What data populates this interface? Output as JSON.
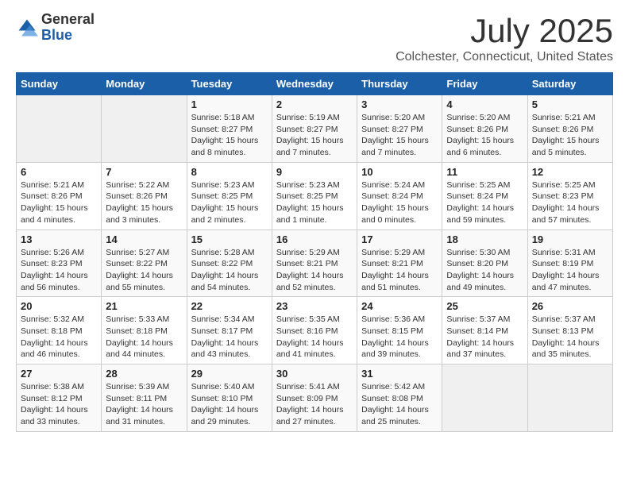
{
  "header": {
    "logo_general": "General",
    "logo_blue": "Blue",
    "title": "July 2025",
    "subtitle": "Colchester, Connecticut, United States"
  },
  "weekdays": [
    "Sunday",
    "Monday",
    "Tuesday",
    "Wednesday",
    "Thursday",
    "Friday",
    "Saturday"
  ],
  "weeks": [
    [
      {
        "day": "",
        "info": ""
      },
      {
        "day": "",
        "info": ""
      },
      {
        "day": "1",
        "info": "Sunrise: 5:18 AM\nSunset: 8:27 PM\nDaylight: 15 hours and 8 minutes."
      },
      {
        "day": "2",
        "info": "Sunrise: 5:19 AM\nSunset: 8:27 PM\nDaylight: 15 hours and 7 minutes."
      },
      {
        "day": "3",
        "info": "Sunrise: 5:20 AM\nSunset: 8:27 PM\nDaylight: 15 hours and 7 minutes."
      },
      {
        "day": "4",
        "info": "Sunrise: 5:20 AM\nSunset: 8:26 PM\nDaylight: 15 hours and 6 minutes."
      },
      {
        "day": "5",
        "info": "Sunrise: 5:21 AM\nSunset: 8:26 PM\nDaylight: 15 hours and 5 minutes."
      }
    ],
    [
      {
        "day": "6",
        "info": "Sunrise: 5:21 AM\nSunset: 8:26 PM\nDaylight: 15 hours and 4 minutes."
      },
      {
        "day": "7",
        "info": "Sunrise: 5:22 AM\nSunset: 8:26 PM\nDaylight: 15 hours and 3 minutes."
      },
      {
        "day": "8",
        "info": "Sunrise: 5:23 AM\nSunset: 8:25 PM\nDaylight: 15 hours and 2 minutes."
      },
      {
        "day": "9",
        "info": "Sunrise: 5:23 AM\nSunset: 8:25 PM\nDaylight: 15 hours and 1 minute."
      },
      {
        "day": "10",
        "info": "Sunrise: 5:24 AM\nSunset: 8:24 PM\nDaylight: 15 hours and 0 minutes."
      },
      {
        "day": "11",
        "info": "Sunrise: 5:25 AM\nSunset: 8:24 PM\nDaylight: 14 hours and 59 minutes."
      },
      {
        "day": "12",
        "info": "Sunrise: 5:25 AM\nSunset: 8:23 PM\nDaylight: 14 hours and 57 minutes."
      }
    ],
    [
      {
        "day": "13",
        "info": "Sunrise: 5:26 AM\nSunset: 8:23 PM\nDaylight: 14 hours and 56 minutes."
      },
      {
        "day": "14",
        "info": "Sunrise: 5:27 AM\nSunset: 8:22 PM\nDaylight: 14 hours and 55 minutes."
      },
      {
        "day": "15",
        "info": "Sunrise: 5:28 AM\nSunset: 8:22 PM\nDaylight: 14 hours and 54 minutes."
      },
      {
        "day": "16",
        "info": "Sunrise: 5:29 AM\nSunset: 8:21 PM\nDaylight: 14 hours and 52 minutes."
      },
      {
        "day": "17",
        "info": "Sunrise: 5:29 AM\nSunset: 8:21 PM\nDaylight: 14 hours and 51 minutes."
      },
      {
        "day": "18",
        "info": "Sunrise: 5:30 AM\nSunset: 8:20 PM\nDaylight: 14 hours and 49 minutes."
      },
      {
        "day": "19",
        "info": "Sunrise: 5:31 AM\nSunset: 8:19 PM\nDaylight: 14 hours and 47 minutes."
      }
    ],
    [
      {
        "day": "20",
        "info": "Sunrise: 5:32 AM\nSunset: 8:18 PM\nDaylight: 14 hours and 46 minutes."
      },
      {
        "day": "21",
        "info": "Sunrise: 5:33 AM\nSunset: 8:18 PM\nDaylight: 14 hours and 44 minutes."
      },
      {
        "day": "22",
        "info": "Sunrise: 5:34 AM\nSunset: 8:17 PM\nDaylight: 14 hours and 43 minutes."
      },
      {
        "day": "23",
        "info": "Sunrise: 5:35 AM\nSunset: 8:16 PM\nDaylight: 14 hours and 41 minutes."
      },
      {
        "day": "24",
        "info": "Sunrise: 5:36 AM\nSunset: 8:15 PM\nDaylight: 14 hours and 39 minutes."
      },
      {
        "day": "25",
        "info": "Sunrise: 5:37 AM\nSunset: 8:14 PM\nDaylight: 14 hours and 37 minutes."
      },
      {
        "day": "26",
        "info": "Sunrise: 5:37 AM\nSunset: 8:13 PM\nDaylight: 14 hours and 35 minutes."
      }
    ],
    [
      {
        "day": "27",
        "info": "Sunrise: 5:38 AM\nSunset: 8:12 PM\nDaylight: 14 hours and 33 minutes."
      },
      {
        "day": "28",
        "info": "Sunrise: 5:39 AM\nSunset: 8:11 PM\nDaylight: 14 hours and 31 minutes."
      },
      {
        "day": "29",
        "info": "Sunrise: 5:40 AM\nSunset: 8:10 PM\nDaylight: 14 hours and 29 minutes."
      },
      {
        "day": "30",
        "info": "Sunrise: 5:41 AM\nSunset: 8:09 PM\nDaylight: 14 hours and 27 minutes."
      },
      {
        "day": "31",
        "info": "Sunrise: 5:42 AM\nSunset: 8:08 PM\nDaylight: 14 hours and 25 minutes."
      },
      {
        "day": "",
        "info": ""
      },
      {
        "day": "",
        "info": ""
      }
    ]
  ]
}
